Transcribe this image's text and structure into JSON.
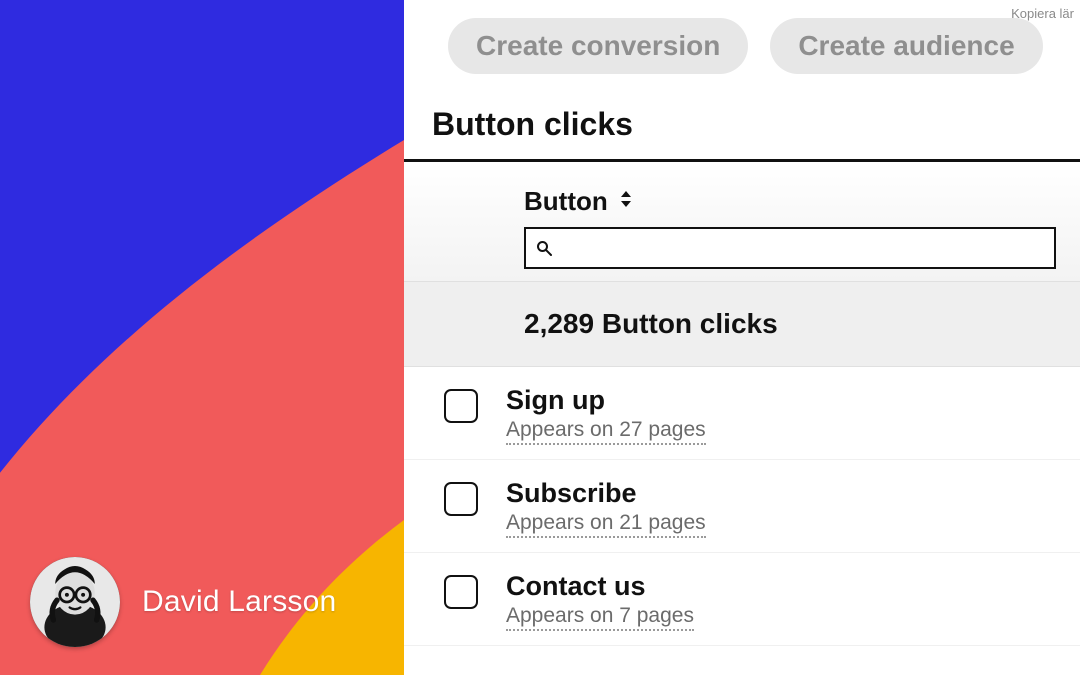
{
  "overlay": {
    "author_name": "David Larsson",
    "kopiera_hint": "Kopiera lär"
  },
  "header": {
    "pill_conversion": "Create conversion",
    "pill_audience": "Create audience"
  },
  "section": {
    "title": "Button clicks",
    "dropdown_label": "Button",
    "search_placeholder": "",
    "count_label": "2,289 Button clicks"
  },
  "items": [
    {
      "title": "Sign up",
      "sub": "Appears on 27 pages"
    },
    {
      "title": "Subscribe",
      "sub": "Appears on 21 pages"
    },
    {
      "title": "Contact us",
      "sub": "Appears on 7 pages"
    }
  ]
}
